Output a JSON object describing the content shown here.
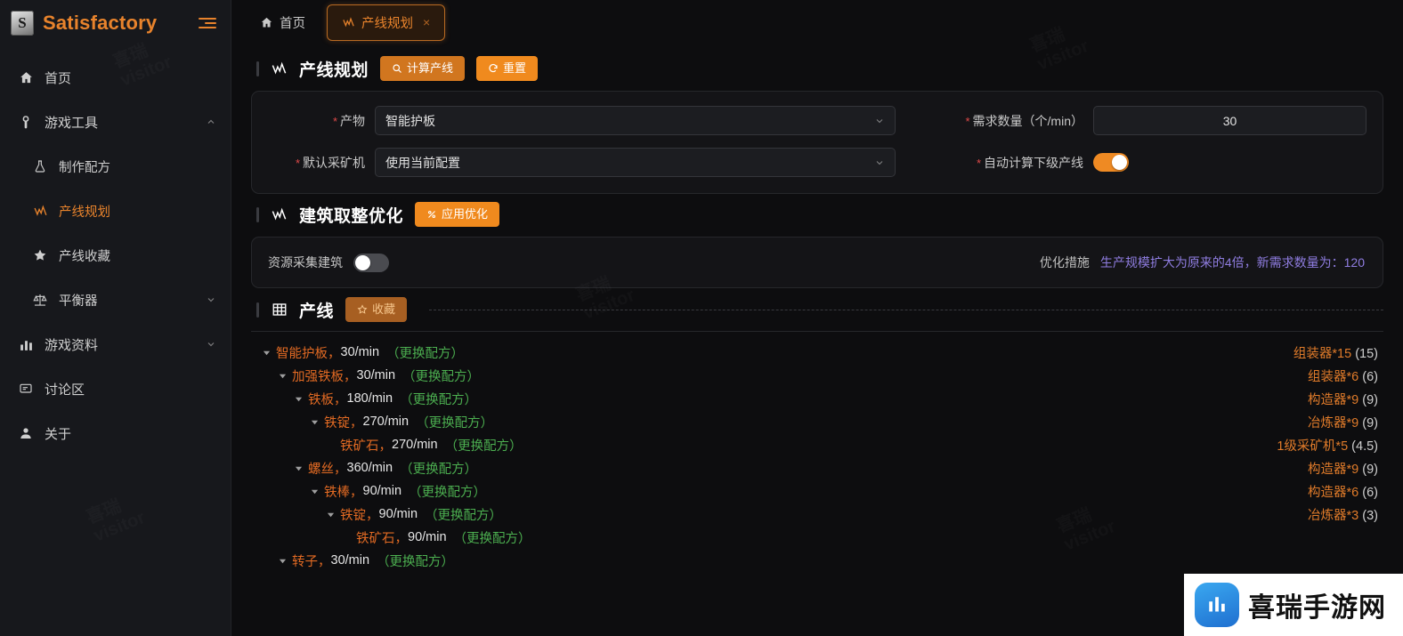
{
  "sidebar": {
    "brand": {
      "logo_letter": "S",
      "title": "Satisfactory",
      "collapse_icon": "collapse-menu-icon"
    },
    "items": [
      {
        "label": "首页",
        "icon": "home-icon",
        "level": 0,
        "active": false,
        "chevron": ""
      },
      {
        "label": "游戏工具",
        "icon": "wrench-icon",
        "level": 0,
        "active": false,
        "chevron": "up"
      },
      {
        "label": "制作配方",
        "icon": "flask-icon",
        "level": 1,
        "active": false,
        "chevron": ""
      },
      {
        "label": "产线规划",
        "icon": "chart-line-icon",
        "level": 1,
        "active": true,
        "chevron": ""
      },
      {
        "label": "产线收藏",
        "icon": "star-icon",
        "level": 1,
        "active": false,
        "chevron": ""
      },
      {
        "label": "平衡器",
        "icon": "scales-icon",
        "level": 1,
        "active": false,
        "chevron": "down"
      },
      {
        "label": "游戏资料",
        "icon": "bar-chart-icon",
        "level": 0,
        "active": false,
        "chevron": "down"
      },
      {
        "label": "讨论区",
        "icon": "comment-icon",
        "level": 0,
        "active": false,
        "chevron": ""
      },
      {
        "label": "关于",
        "icon": "user-icon",
        "level": 0,
        "active": false,
        "chevron": ""
      }
    ]
  },
  "tabs": [
    {
      "label": "首页",
      "icon": "home-icon",
      "active": false,
      "closable": false
    },
    {
      "label": "产线规划",
      "icon": "chart-line-icon",
      "active": true,
      "closable": true,
      "close_glyph": "×"
    }
  ],
  "planner": {
    "title": "产线规划",
    "title_icon": "chart-line-icon",
    "calc_button": {
      "label": "计算产线",
      "icon": "search-icon"
    },
    "reset_button": {
      "label": "重置",
      "icon": "refresh-icon"
    },
    "fields": {
      "product_label": "产物",
      "product_value": "智能护板",
      "demand_label": "需求数量（个/min）",
      "demand_value": "30",
      "miner_label": "默认采矿机",
      "miner_value": "使用当前配置",
      "auto_label": "自动计算下级产线",
      "auto_on": true
    }
  },
  "optimize": {
    "title": "建筑取整优化",
    "title_icon": "chart-line-icon",
    "apply_button": {
      "label": "应用优化",
      "icon": "percent-icon"
    },
    "resource_label": "资源采集建筑",
    "resource_on": false,
    "measure_label": "优化措施",
    "measure_text": "生产规模扩大为原来的4倍，新需求数量为：120"
  },
  "production": {
    "title": "产线",
    "title_icon": "grid-icon",
    "fav_button": {
      "label": "收藏",
      "icon": "star-icon"
    },
    "swap_label": "更换配方",
    "rows": [
      {
        "indent": 0,
        "arrow": true,
        "name": "智能护板",
        "rate": "30/min",
        "building": "组装器",
        "count": "*15",
        "actual": "(15)"
      },
      {
        "indent": 1,
        "arrow": true,
        "name": "加强铁板",
        "rate": "30/min",
        "building": "组装器",
        "count": "*6",
        "actual": "(6)"
      },
      {
        "indent": 2,
        "arrow": true,
        "name": "铁板",
        "rate": "180/min",
        "building": "构造器",
        "count": "*9",
        "actual": "(9)"
      },
      {
        "indent": 3,
        "arrow": true,
        "name": "铁锭",
        "rate": "270/min",
        "building": "冶炼器",
        "count": "*9",
        "actual": "(9)"
      },
      {
        "indent": 4,
        "arrow": false,
        "name": "铁矿石",
        "rate": "270/min",
        "building": "1级采矿机",
        "count": "*5",
        "actual": "(4.5)"
      },
      {
        "indent": 2,
        "arrow": true,
        "name": "螺丝",
        "rate": "360/min",
        "building": "构造器",
        "count": "*9",
        "actual": "(9)"
      },
      {
        "indent": 3,
        "arrow": true,
        "name": "铁棒",
        "rate": "90/min",
        "building": "构造器",
        "count": "*6",
        "actual": "(6)"
      },
      {
        "indent": 4,
        "arrow": true,
        "name": "铁锭",
        "rate": "90/min",
        "building": "冶炼器",
        "count": "*3",
        "actual": "(3)"
      },
      {
        "indent": 5,
        "arrow": false,
        "name": "铁矿石",
        "rate": "90/min",
        "building": "",
        "count": "",
        "actual": ""
      },
      {
        "indent": 1,
        "arrow": true,
        "name": "转子",
        "rate": "30/min",
        "building": "",
        "count": "",
        "actual": ""
      }
    ]
  },
  "watermark": {
    "text": "喜瑞\nvisitor",
    "logo_text": "喜瑞手游网"
  },
  "colors": {
    "accent": "#e8832c",
    "orange": "#f08a1e",
    "green": "#4caf50",
    "purple": "#8f7de0",
    "required": "#e04a4a"
  }
}
